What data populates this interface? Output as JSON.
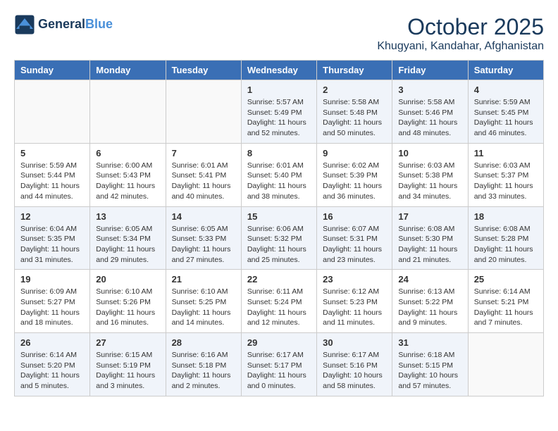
{
  "header": {
    "logo_line1": "General",
    "logo_line2": "Blue",
    "month": "October 2025",
    "location": "Khugyani, Kandahar, Afghanistan"
  },
  "days_of_week": [
    "Sunday",
    "Monday",
    "Tuesday",
    "Wednesday",
    "Thursday",
    "Friday",
    "Saturday"
  ],
  "weeks": [
    [
      {
        "day": "",
        "info": ""
      },
      {
        "day": "",
        "info": ""
      },
      {
        "day": "",
        "info": ""
      },
      {
        "day": "1",
        "info": "Sunrise: 5:57 AM\nSunset: 5:49 PM\nDaylight: 11 hours and 52 minutes."
      },
      {
        "day": "2",
        "info": "Sunrise: 5:58 AM\nSunset: 5:48 PM\nDaylight: 11 hours and 50 minutes."
      },
      {
        "day": "3",
        "info": "Sunrise: 5:58 AM\nSunset: 5:46 PM\nDaylight: 11 hours and 48 minutes."
      },
      {
        "day": "4",
        "info": "Sunrise: 5:59 AM\nSunset: 5:45 PM\nDaylight: 11 hours and 46 minutes."
      }
    ],
    [
      {
        "day": "5",
        "info": "Sunrise: 5:59 AM\nSunset: 5:44 PM\nDaylight: 11 hours and 44 minutes."
      },
      {
        "day": "6",
        "info": "Sunrise: 6:00 AM\nSunset: 5:43 PM\nDaylight: 11 hours and 42 minutes."
      },
      {
        "day": "7",
        "info": "Sunrise: 6:01 AM\nSunset: 5:41 PM\nDaylight: 11 hours and 40 minutes."
      },
      {
        "day": "8",
        "info": "Sunrise: 6:01 AM\nSunset: 5:40 PM\nDaylight: 11 hours and 38 minutes."
      },
      {
        "day": "9",
        "info": "Sunrise: 6:02 AM\nSunset: 5:39 PM\nDaylight: 11 hours and 36 minutes."
      },
      {
        "day": "10",
        "info": "Sunrise: 6:03 AM\nSunset: 5:38 PM\nDaylight: 11 hours and 34 minutes."
      },
      {
        "day": "11",
        "info": "Sunrise: 6:03 AM\nSunset: 5:37 PM\nDaylight: 11 hours and 33 minutes."
      }
    ],
    [
      {
        "day": "12",
        "info": "Sunrise: 6:04 AM\nSunset: 5:35 PM\nDaylight: 11 hours and 31 minutes."
      },
      {
        "day": "13",
        "info": "Sunrise: 6:05 AM\nSunset: 5:34 PM\nDaylight: 11 hours and 29 minutes."
      },
      {
        "day": "14",
        "info": "Sunrise: 6:05 AM\nSunset: 5:33 PM\nDaylight: 11 hours and 27 minutes."
      },
      {
        "day": "15",
        "info": "Sunrise: 6:06 AM\nSunset: 5:32 PM\nDaylight: 11 hours and 25 minutes."
      },
      {
        "day": "16",
        "info": "Sunrise: 6:07 AM\nSunset: 5:31 PM\nDaylight: 11 hours and 23 minutes."
      },
      {
        "day": "17",
        "info": "Sunrise: 6:08 AM\nSunset: 5:30 PM\nDaylight: 11 hours and 21 minutes."
      },
      {
        "day": "18",
        "info": "Sunrise: 6:08 AM\nSunset: 5:28 PM\nDaylight: 11 hours and 20 minutes."
      }
    ],
    [
      {
        "day": "19",
        "info": "Sunrise: 6:09 AM\nSunset: 5:27 PM\nDaylight: 11 hours and 18 minutes."
      },
      {
        "day": "20",
        "info": "Sunrise: 6:10 AM\nSunset: 5:26 PM\nDaylight: 11 hours and 16 minutes."
      },
      {
        "day": "21",
        "info": "Sunrise: 6:10 AM\nSunset: 5:25 PM\nDaylight: 11 hours and 14 minutes."
      },
      {
        "day": "22",
        "info": "Sunrise: 6:11 AM\nSunset: 5:24 PM\nDaylight: 11 hours and 12 minutes."
      },
      {
        "day": "23",
        "info": "Sunrise: 6:12 AM\nSunset: 5:23 PM\nDaylight: 11 hours and 11 minutes."
      },
      {
        "day": "24",
        "info": "Sunrise: 6:13 AM\nSunset: 5:22 PM\nDaylight: 11 hours and 9 minutes."
      },
      {
        "day": "25",
        "info": "Sunrise: 6:14 AM\nSunset: 5:21 PM\nDaylight: 11 hours and 7 minutes."
      }
    ],
    [
      {
        "day": "26",
        "info": "Sunrise: 6:14 AM\nSunset: 5:20 PM\nDaylight: 11 hours and 5 minutes."
      },
      {
        "day": "27",
        "info": "Sunrise: 6:15 AM\nSunset: 5:19 PM\nDaylight: 11 hours and 3 minutes."
      },
      {
        "day": "28",
        "info": "Sunrise: 6:16 AM\nSunset: 5:18 PM\nDaylight: 11 hours and 2 minutes."
      },
      {
        "day": "29",
        "info": "Sunrise: 6:17 AM\nSunset: 5:17 PM\nDaylight: 11 hours and 0 minutes."
      },
      {
        "day": "30",
        "info": "Sunrise: 6:17 AM\nSunset: 5:16 PM\nDaylight: 10 hours and 58 minutes."
      },
      {
        "day": "31",
        "info": "Sunrise: 6:18 AM\nSunset: 5:15 PM\nDaylight: 10 hours and 57 minutes."
      },
      {
        "day": "",
        "info": ""
      }
    ]
  ]
}
